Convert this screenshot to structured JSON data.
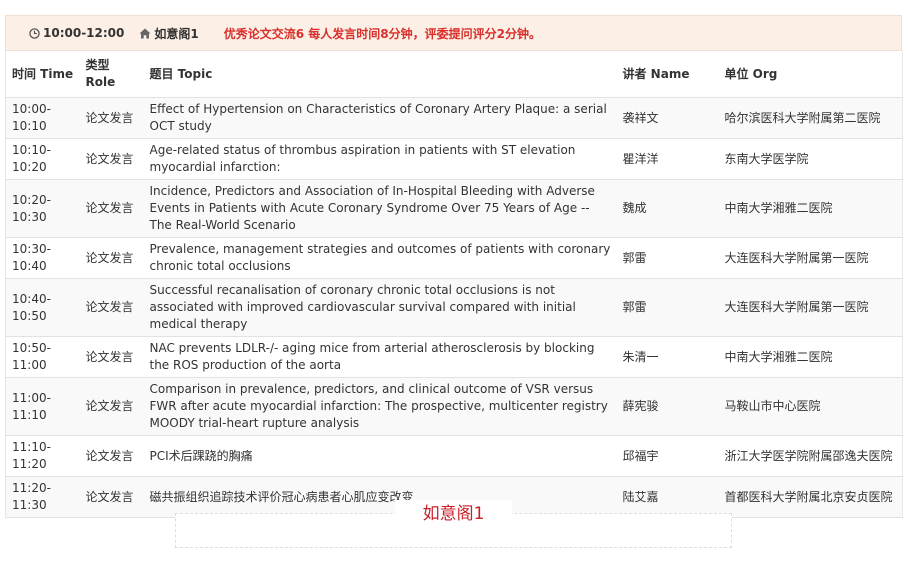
{
  "session": {
    "time": "10:00-12:00",
    "venue": "如意阁1",
    "description": "优秀论文交流6 每人发言时间8分钟，评委提问评分2分钟。"
  },
  "table": {
    "headers": {
      "time": "时间 Time",
      "role": "类型 Role",
      "topic": "题目 Topic",
      "speaker": "讲者 Name",
      "org": "单位 Org"
    },
    "rows": [
      {
        "time": "10:00-10:10",
        "role": "论文发言",
        "topic": "Effect of Hypertension on Characteristics of Coronary Artery Plaque: a serial OCT study",
        "speaker": "袭祥文",
        "org": "哈尔滨医科大学附属第二医院"
      },
      {
        "time": "10:10-10:20",
        "role": "论文发言",
        "topic": "Age-related status of thrombus aspiration in patients with ST elevation myocardial infarction:",
        "speaker": "瞿洋洋",
        "org": "东南大学医学院"
      },
      {
        "time": "10:20-10:30",
        "role": "论文发言",
        "topic": "Incidence, Predictors and Association of In-Hospital Bleeding with Adverse Events in Patients with Acute Coronary Syndrome Over 75 Years of Age --The Real-World Scenario",
        "speaker": "魏成",
        "org": "中南大学湘雅二医院"
      },
      {
        "time": "10:30-10:40",
        "role": "论文发言",
        "topic": "Prevalence, management strategies and outcomes of patients with coronary chronic total occlusions",
        "speaker": "郭雷",
        "org": "大连医科大学附属第一医院"
      },
      {
        "time": "10:40-10:50",
        "role": "论文发言",
        "topic": "Successful recanalisation of coronary chronic total occlusions is not associated with improved cardiovascular survival compared with initial medical therapy",
        "speaker": "郭雷",
        "org": "大连医科大学附属第一医院"
      },
      {
        "time": "10:50-11:00",
        "role": "论文发言",
        "topic": "NAC prevents LDLR-/- aging mice from arterial atherosclerosis by blocking the ROS production of the aorta",
        "speaker": "朱清一",
        "org": "中南大学湘雅二医院"
      },
      {
        "time": "11:00-11:10",
        "role": "论文发言",
        "topic": "Comparison in prevalence, predictors, and clinical outcome of VSR versus FWR after acute myocardial infarction: The prospective, multicenter registry MOODY trial-heart rupture analysis",
        "speaker": "薛宪骏",
        "org": "马鞍山市中心医院"
      },
      {
        "time": "11:10-11:20",
        "role": "论文发言",
        "topic": "PCI术后踝跷的胸痛",
        "speaker": "邱福宇",
        "org": "浙江大学医学院附属邵逸夫医院"
      },
      {
        "time": "11:20-11:30",
        "role": "论文发言",
        "topic": "磁共振组织追踪技术评价冠心病患者心肌应变改变",
        "speaker": "陆艾嘉",
        "org": "首都医科大学附属北京安贞医院"
      }
    ]
  },
  "footer": {
    "venue_title": "如意阁1"
  },
  "colors": {
    "accent": "#d9302c",
    "venue_title": "#c8202b",
    "banner_bg": "#fcefe6"
  },
  "icons": {
    "time": "clock-icon",
    "venue": "home-icon"
  }
}
